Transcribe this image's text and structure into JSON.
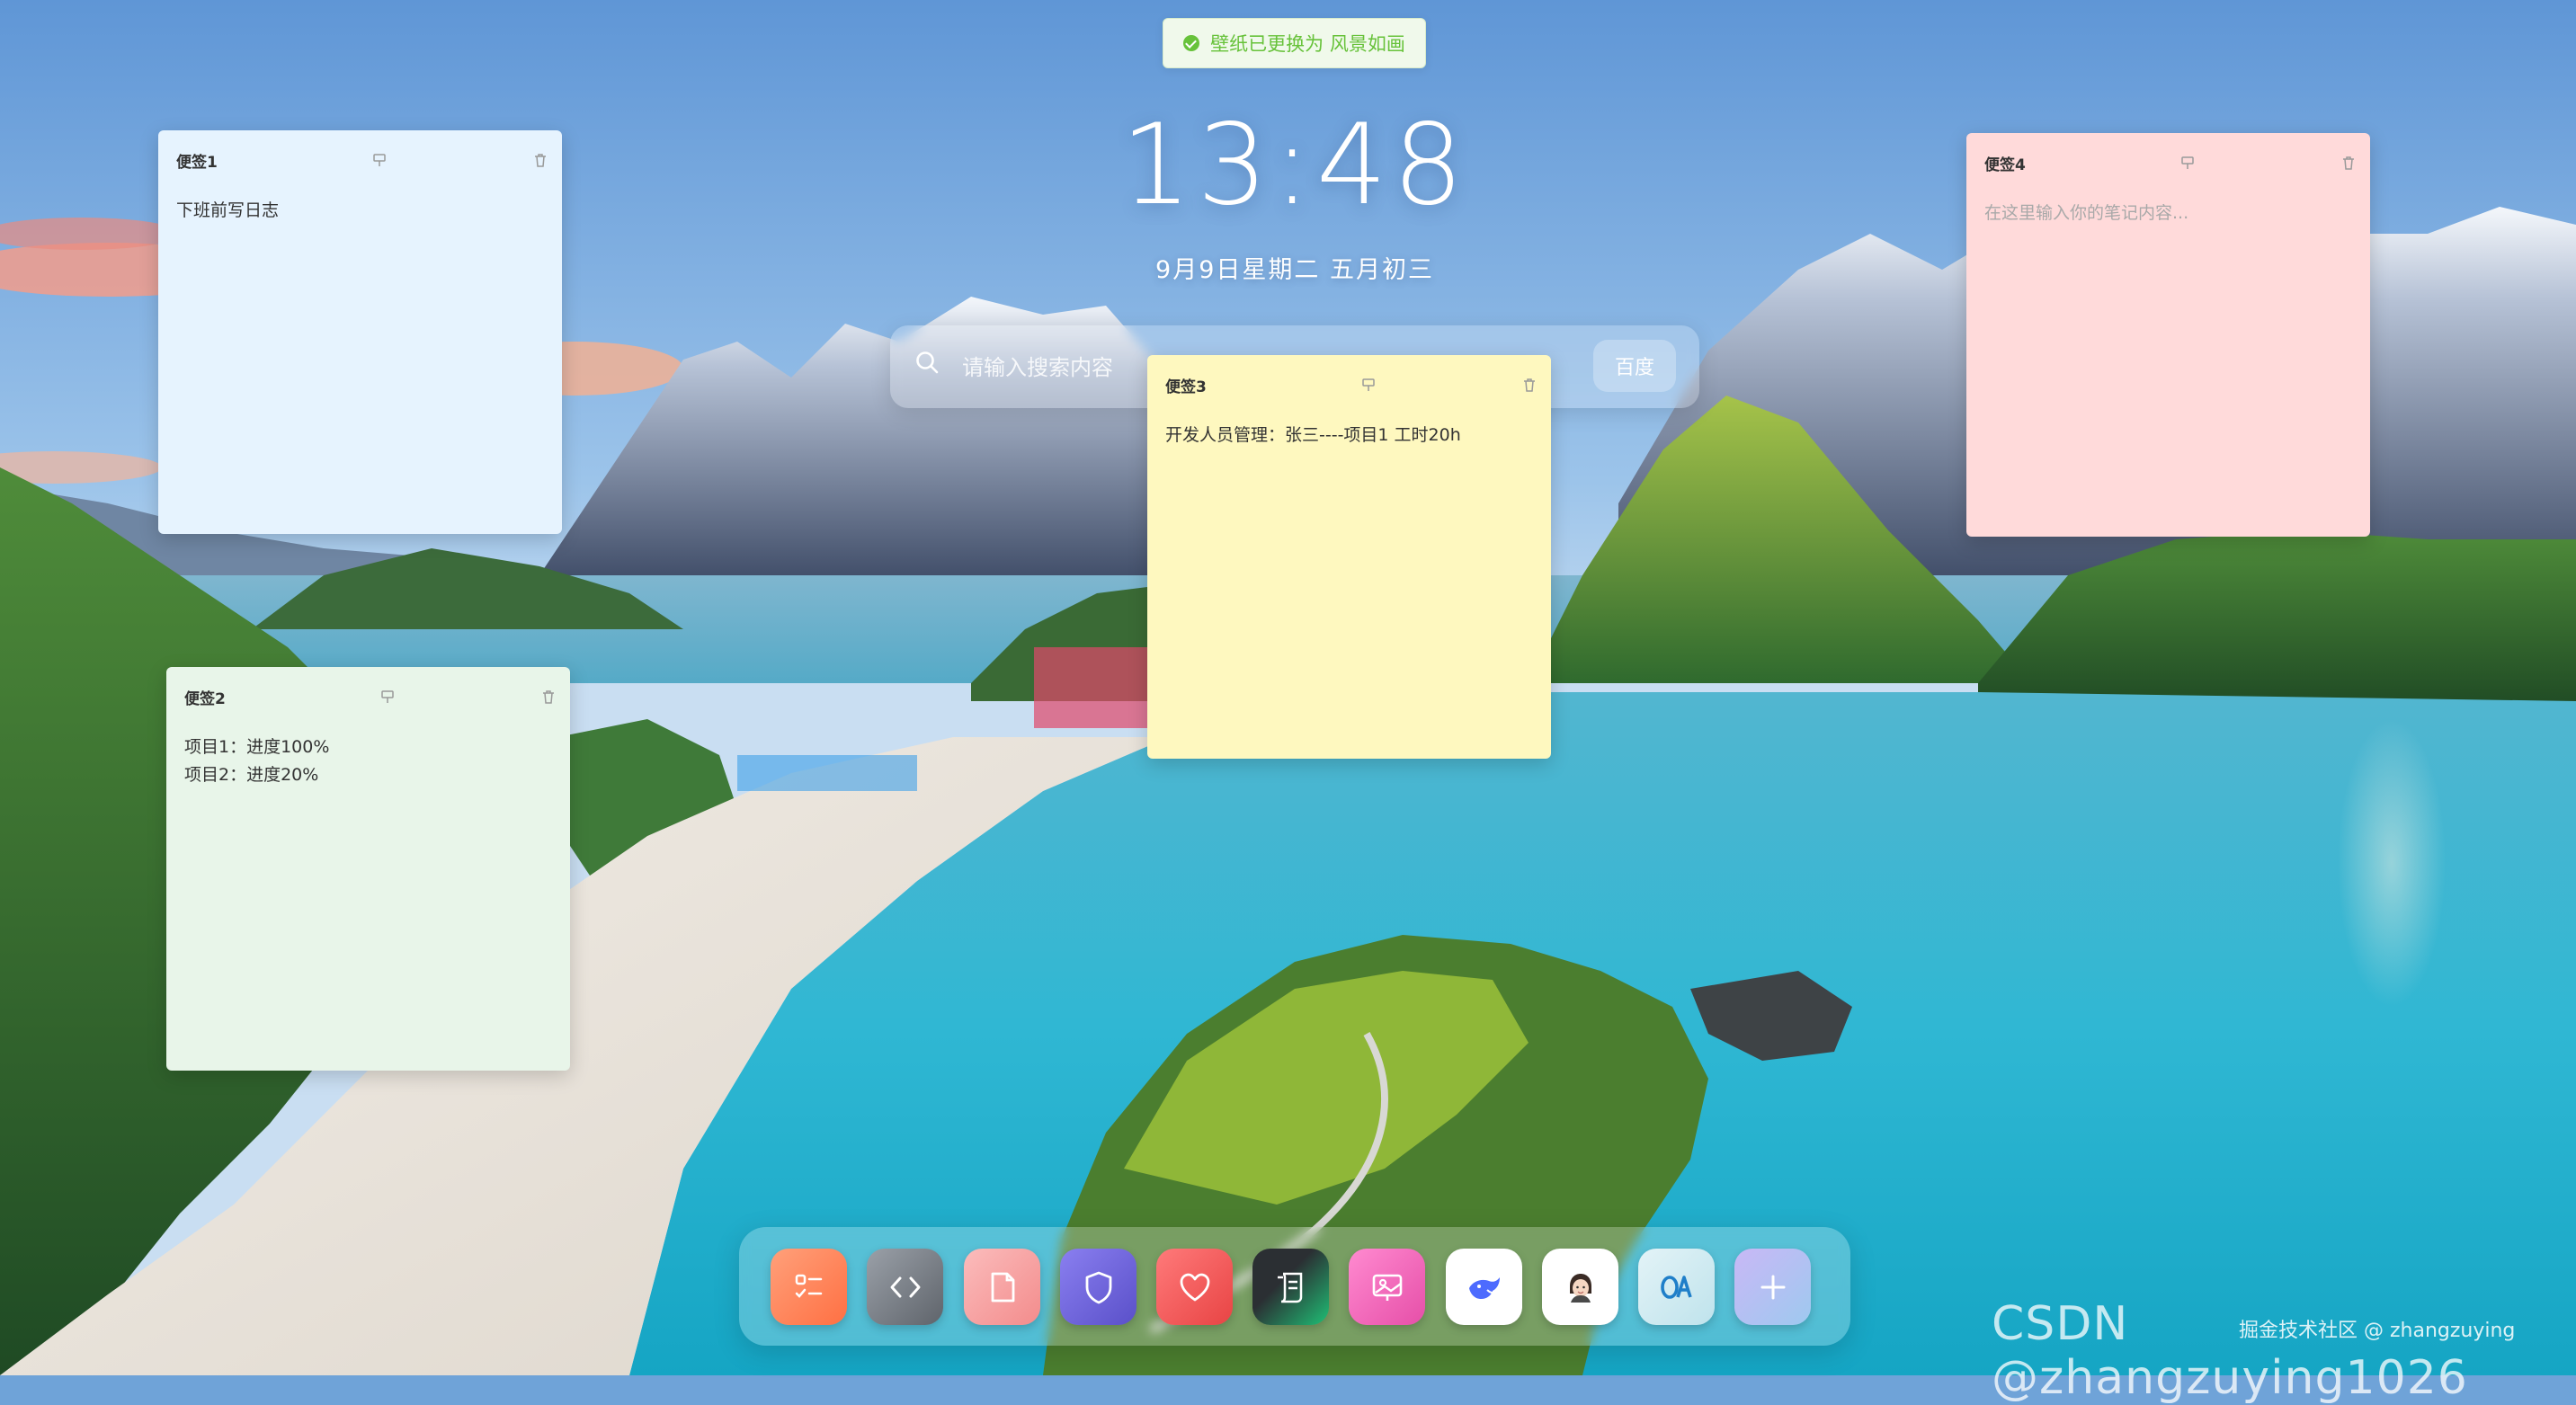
{
  "toast": {
    "text": "壁纸已更换为 风景如画",
    "color": "#67c23a"
  },
  "clock": {
    "time": "13:48",
    "date": "9月9日星期二 五月初三"
  },
  "search": {
    "placeholder": "请输入搜索内容",
    "engine_label": "百度"
  },
  "notes": [
    {
      "title": "便签1",
      "content": "下班前写日志",
      "color": "#e6f3fe"
    },
    {
      "title": "便签2",
      "content": "项目1：进度100%\n项目2：进度20%",
      "color": "#e8f5e9"
    },
    {
      "title": "便签3",
      "content": "开发人员管理：张三----项目1   工时20h",
      "color": "#fef8bf"
    },
    {
      "title": "便签4",
      "content": "",
      "placeholder": "在这里输入你的笔记内容...",
      "color": "#ffdada"
    }
  ],
  "dock": {
    "items": [
      {
        "icon": "checklist-icon",
        "color": "#ff8a65"
      },
      {
        "icon": "code-icon",
        "color": "#7b7f86"
      },
      {
        "icon": "document-icon",
        "color": "#f8a5a5"
      },
      {
        "icon": "shield-icon",
        "color": "#6c63d9"
      },
      {
        "icon": "heart-icon",
        "color": "#f05a5a"
      },
      {
        "icon": "receipt-icon",
        "color": "#2d3b36"
      },
      {
        "icon": "image-icon",
        "color": "#f06bb9"
      },
      {
        "icon": "whale-icon",
        "color": "#ffffff"
      },
      {
        "icon": "avatar-icon",
        "color": "#ffffff"
      },
      {
        "icon": "oa-icon",
        "color": "#d3ecf2"
      },
      {
        "icon": "add-icon",
        "color": "#b7b8f0"
      }
    ]
  },
  "watermark": {
    "small": "掘金技术社区 @ zhangzuying",
    "large": "CSDN @zhangzuying1026"
  }
}
